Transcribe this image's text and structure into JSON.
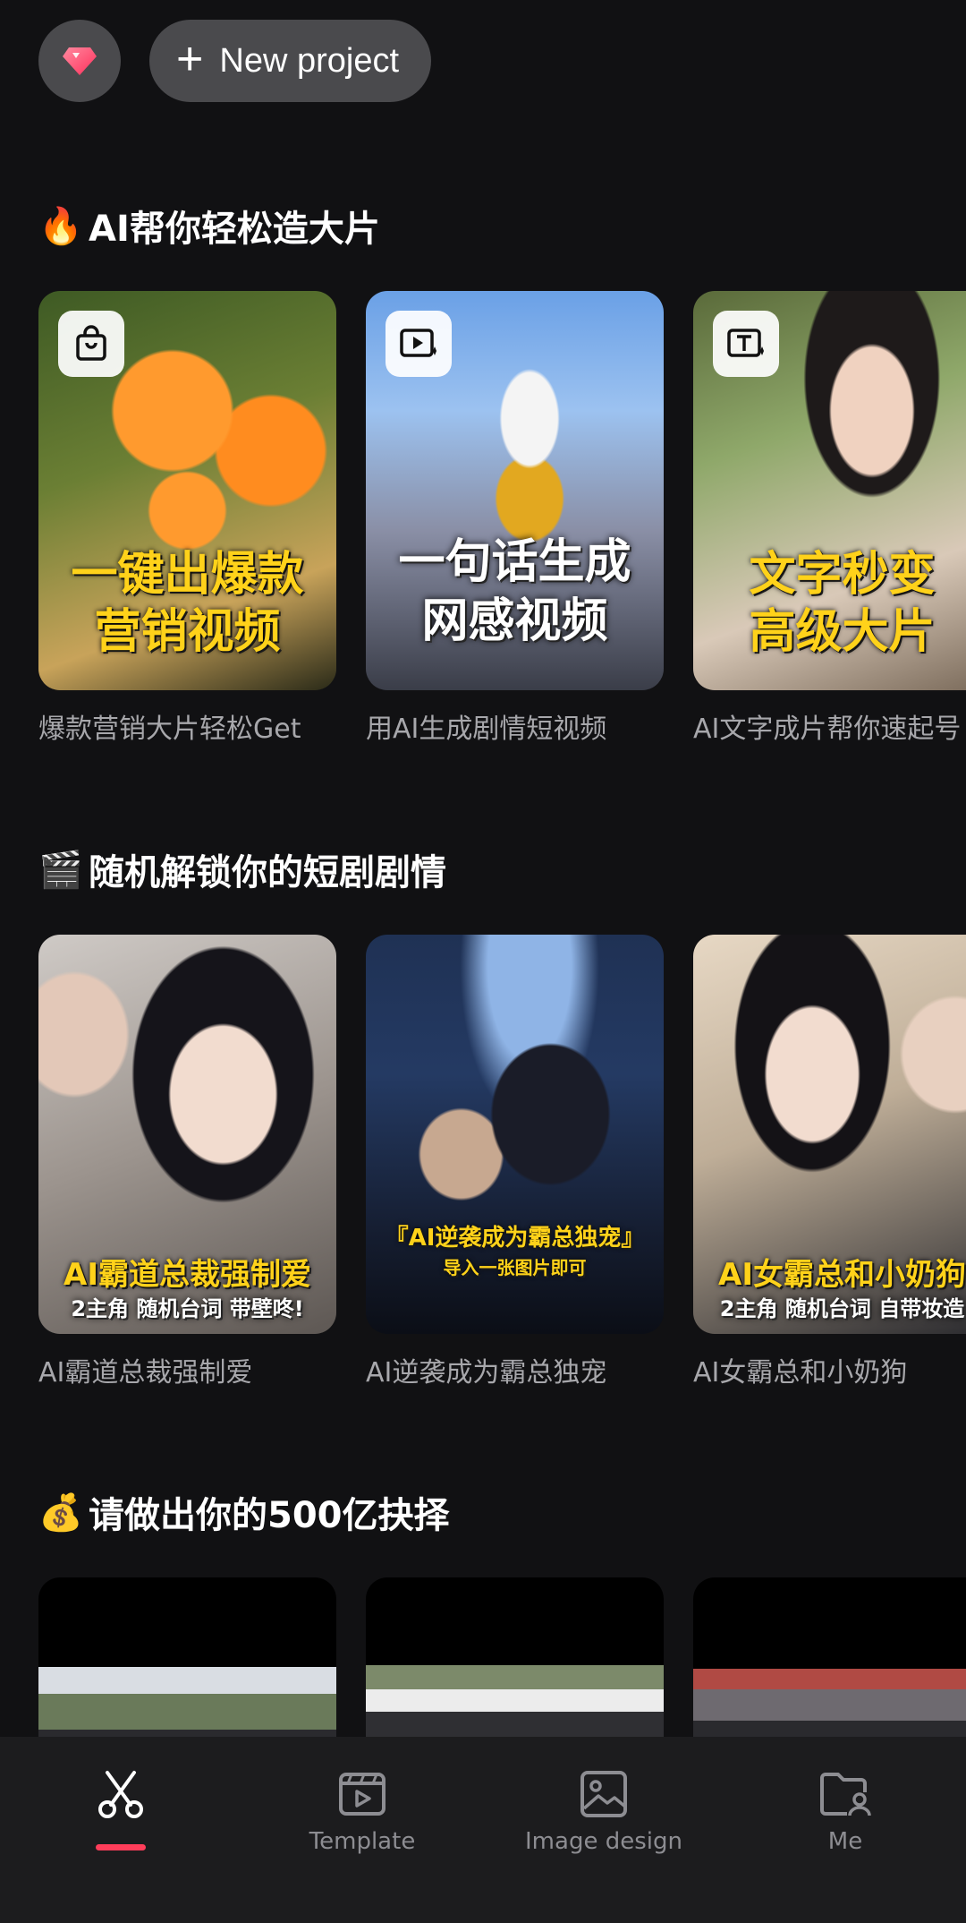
{
  "header": {
    "premium_icon": "gem-icon",
    "new_project_label": "New project"
  },
  "sections": [
    {
      "emoji": "🔥",
      "title": "AI帮你轻松造大片",
      "cards": [
        {
          "caption": "爆款营销大片轻松Get",
          "badge_icon": "shopping-bag-icon",
          "overlay": "一键出爆款\n营销视频"
        },
        {
          "caption": "用AI生成剧情短视频",
          "badge_icon": "video-sparkle-icon",
          "overlay": "一句话生成\n网感视频"
        },
        {
          "caption": "AI文字成片帮你速起号",
          "badge_icon": "text-sparkle-icon",
          "overlay": "文字秒变\n高级大片"
        }
      ]
    },
    {
      "emoji": "🎬",
      "title": "随机解锁你的短剧剧情",
      "cards": [
        {
          "caption": "AI霸道总裁强制爱",
          "overlay": "AI霸道总裁强制爱",
          "sub": "2主角 随机台词 带壁咚!"
        },
        {
          "caption": "AI逆袭成为霸总独宠",
          "overlay": "『AI逆袭成为霸总独宠』",
          "sub": "导入一张图片即可"
        },
        {
          "caption": "AI女霸总和小奶狗",
          "overlay": "AI女霸总和小奶狗",
          "sub": "2主角 随机台词 自带妆造"
        }
      ]
    },
    {
      "emoji": "💰",
      "title": "请做出你的500亿抉择",
      "cards": [
        {
          "caption": ""
        },
        {
          "caption": ""
        },
        {
          "caption": ""
        }
      ]
    }
  ],
  "bottom_nav": [
    {
      "label": "",
      "icon": "scissors-icon",
      "active": true
    },
    {
      "label": "Template",
      "icon": "template-icon",
      "active": false
    },
    {
      "label": "Image design",
      "icon": "image-icon",
      "active": false
    },
    {
      "label": "Me",
      "icon": "profile-folder-icon",
      "active": false
    }
  ],
  "colors": {
    "background": "#111113",
    "accent": "#ff3d5a",
    "caption": "#a7a7ab"
  }
}
